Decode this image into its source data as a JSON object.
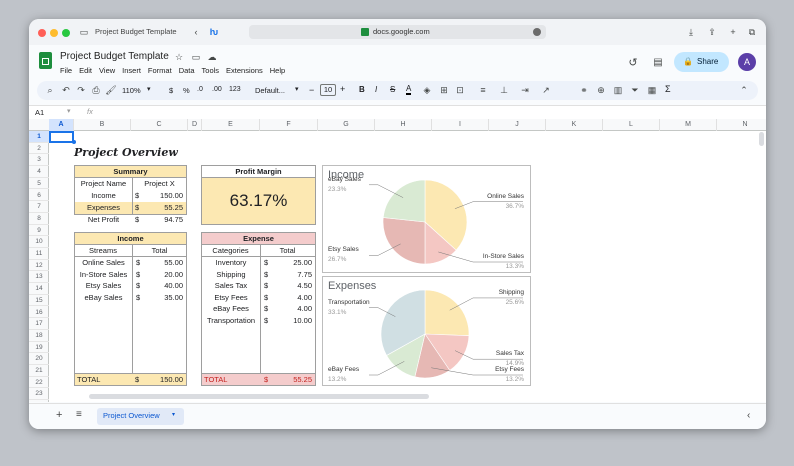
{
  "browser": {
    "tab_title": "Project Budget Template",
    "url": "docs.google.com"
  },
  "doc": {
    "title": "Project Budget Template",
    "menu": [
      "File",
      "Edit",
      "View",
      "Insert",
      "Format",
      "Data",
      "Tools",
      "Extensions",
      "Help"
    ],
    "share": "Share",
    "avatar": "A"
  },
  "toolbar": {
    "zoom": "110%",
    "currency": "$",
    "percent": "%",
    "dec_dec": ".0",
    "inc_dec": ".00",
    "num_fmt": "123",
    "font": "Default...",
    "font_size": "10",
    "bold": "B",
    "italic": "I",
    "strike": "S",
    "text_color": "A",
    "sum": "Σ"
  },
  "formula": {
    "cell_ref": "A1",
    "fx": "fx",
    "value": ""
  },
  "cols": [
    "A",
    "B",
    "C",
    "D",
    "E",
    "F",
    "G",
    "H",
    "I",
    "J",
    "K",
    "L",
    "M",
    "N"
  ],
  "rows": [
    "1",
    "2",
    "3",
    "4",
    "5",
    "6",
    "7",
    "8",
    "9",
    "10",
    "11",
    "12",
    "13",
    "14",
    "15",
    "16",
    "17",
    "18",
    "19",
    "20",
    "21",
    "22",
    "23"
  ],
  "sheet": {
    "title": "Project Overview",
    "summary": {
      "header": "Summary",
      "rows": [
        {
          "label": "Project Name",
          "cur": "",
          "value": "Project X"
        },
        {
          "label": "Income",
          "cur": "$",
          "value": "150.00"
        },
        {
          "label": "Expenses",
          "cur": "$",
          "value": "55.25"
        },
        {
          "label": "Net Profit",
          "cur": "$",
          "value": "94.75"
        }
      ]
    },
    "profit": {
      "header": "Profit Margin",
      "value": "63.17%"
    },
    "income": {
      "header": "Income",
      "col1": "Streams",
      "col2": "Total",
      "rows": [
        {
          "name": "Online Sales",
          "cur": "$",
          "value": "55.00"
        },
        {
          "name": "In-Store Sales",
          "cur": "$",
          "value": "20.00"
        },
        {
          "name": "Etsy Sales",
          "cur": "$",
          "value": "40.00"
        },
        {
          "name": "eBay Sales",
          "cur": "$",
          "value": "35.00"
        }
      ],
      "total_label": "TOTAL",
      "total_cur": "$",
      "total": "150.00"
    },
    "expense": {
      "header": "Expense",
      "col1": "Categories",
      "col2": "Total",
      "rows": [
        {
          "name": "Inventory",
          "cur": "$",
          "value": "25.00"
        },
        {
          "name": "Shipping",
          "cur": "$",
          "value": "7.75"
        },
        {
          "name": "Sales Tax",
          "cur": "$",
          "value": "4.50"
        },
        {
          "name": "Etsy Fees",
          "cur": "$",
          "value": "4.00"
        },
        {
          "name": "eBay Fees",
          "cur": "$",
          "value": "4.00"
        },
        {
          "name": "Transportation",
          "cur": "$",
          "value": "10.00"
        }
      ],
      "total_label": "TOTAL",
      "total_cur": "$",
      "total": "55.25"
    }
  },
  "chart_data": [
    {
      "type": "pie",
      "title": "Income",
      "start_angle_deg": 0,
      "slices": [
        {
          "label": "Online Sales",
          "value": 36.7,
          "pct": "36.7%",
          "color": "#fce8b2"
        },
        {
          "label": "In-Store Sales",
          "value": 13.3,
          "pct": "13.3%",
          "color": "#f4c7c3"
        },
        {
          "label": "Etsy Sales",
          "value": 26.7,
          "pct": "26.7%",
          "color": "#e6b8b4"
        },
        {
          "label": "eBay Sales",
          "value": 23.3,
          "pct": "23.3%",
          "color": "#d9ead3"
        }
      ]
    },
    {
      "type": "pie",
      "title": "Expenses",
      "start_angle_deg": 0,
      "slices": [
        {
          "label": "Shipping",
          "value": 25.6,
          "pct": "25.6%",
          "color": "#fce8b2"
        },
        {
          "label": "Sales Tax",
          "value": 14.9,
          "pct": "14.9%",
          "color": "#f4c7c3"
        },
        {
          "label": "Etsy Fees",
          "value": 13.2,
          "pct": "13.2%",
          "color": "#e6b8b4"
        },
        {
          "label": "eBay Fees",
          "value": 13.2,
          "pct": "13.2%",
          "color": "#d9ead3"
        },
        {
          "label": "Transportation",
          "value": 33.1,
          "pct": "33.1%",
          "color": "#d0dfe3"
        }
      ]
    }
  ],
  "tabs": {
    "add": "+",
    "list": "≡",
    "active": "Project Overview"
  },
  "colors": {
    "accent": "#0b57d0",
    "summary_fill": "#fce8b2",
    "expense_fill": "#f4cccc",
    "share_bg": "#c2e7ff"
  }
}
